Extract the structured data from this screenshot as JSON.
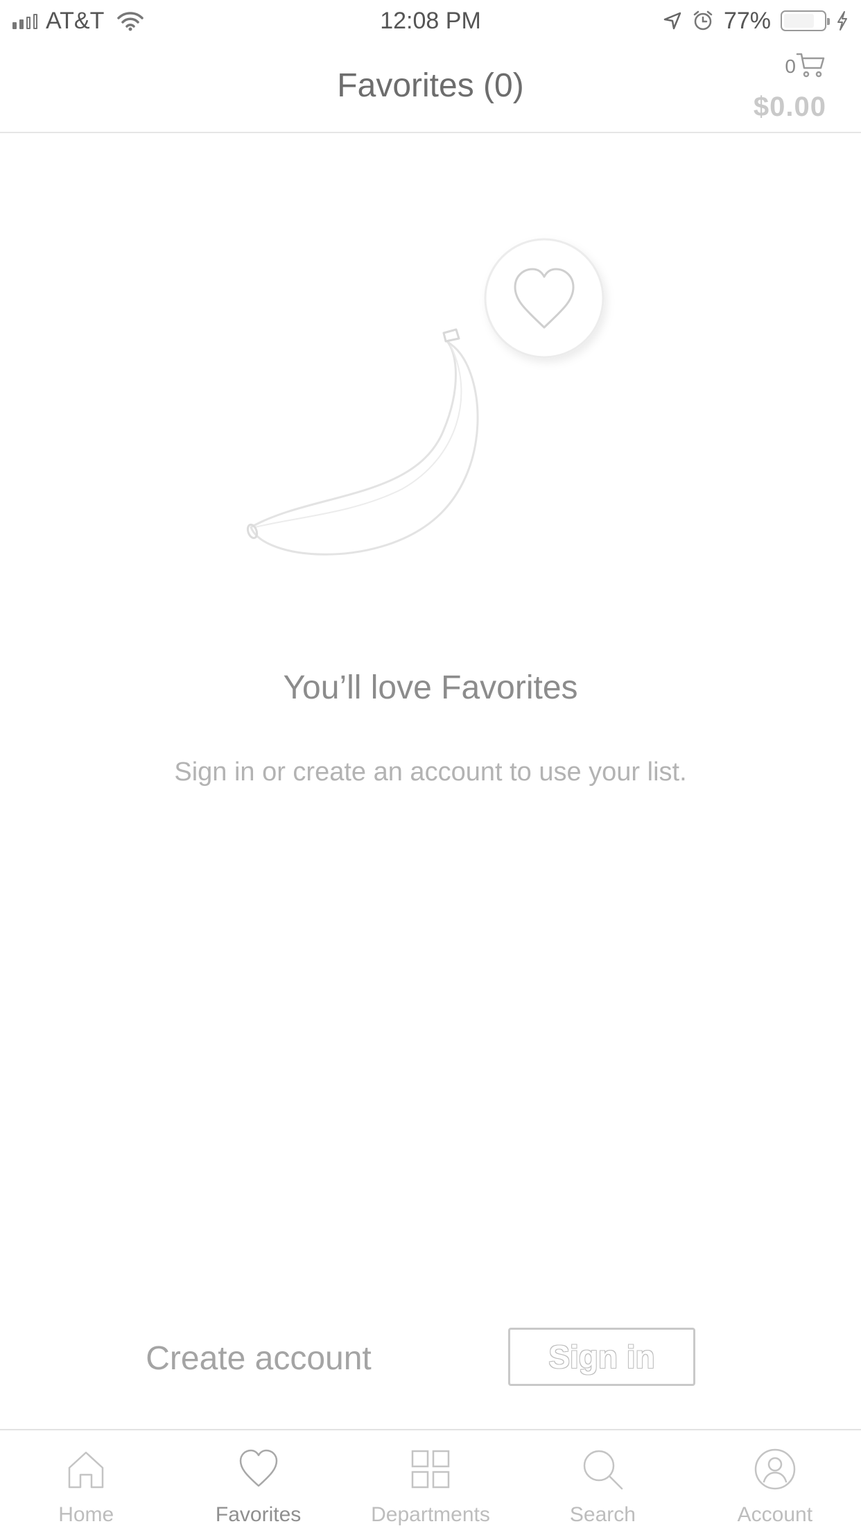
{
  "status_bar": {
    "carrier": "AT&T",
    "time": "12:08 PM",
    "battery_percent": "77%",
    "battery_level": 0.77,
    "icons": [
      "signal-icon",
      "wifi-icon",
      "location-arrow-icon",
      "alarm-icon",
      "battery-icon",
      "charging-bolt-icon"
    ]
  },
  "header": {
    "title": "Favorites (0)",
    "cart_count": "0",
    "cart_total": "$0.00",
    "cart_icon": "cart-icon"
  },
  "empty_state": {
    "title": "You’ll love Favorites",
    "subtitle": "Sign in or create an account to use your list.",
    "illustration": [
      "banana-icon",
      "heart-icon"
    ]
  },
  "actions": {
    "create_account_label": "Create account",
    "sign_in_label": "Sign in"
  },
  "tab_bar": {
    "tabs": [
      {
        "label": "Home",
        "icon": "home-icon",
        "active": false
      },
      {
        "label": "Favorites",
        "icon": "heart-icon",
        "active": true
      },
      {
        "label": "Departments",
        "icon": "grid-icon",
        "active": false
      },
      {
        "label": "Search",
        "icon": "search-icon",
        "active": false
      },
      {
        "label": "Account",
        "icon": "account-icon",
        "active": false
      }
    ]
  },
  "colors": {
    "text_primary": "#6d6d6d",
    "text_muted": "#b3b3b3",
    "divider": "#e6e6e6",
    "tab_active": "#8f8f8f",
    "tab_inactive": "#bdbdbd"
  }
}
